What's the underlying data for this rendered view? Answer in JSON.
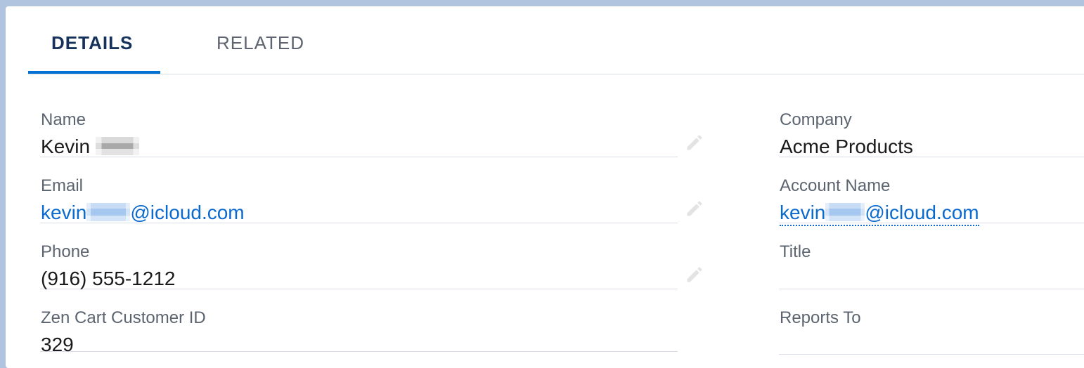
{
  "tabs": [
    {
      "label": "DETAILS",
      "active": true
    },
    {
      "label": "RELATED",
      "active": false
    }
  ],
  "left_fields": [
    {
      "label": "Name",
      "value_prefix": "Kevin",
      "value_suffix": ""
    },
    {
      "label": "Email",
      "value_prefix": "kevin",
      "value_suffix": "@icloud.com"
    },
    {
      "label": "Phone",
      "value": "(916) 555-1212"
    },
    {
      "label": "Zen Cart Customer ID",
      "value": "329"
    }
  ],
  "right_fields": [
    {
      "label": "Company",
      "value": "Acme Products"
    },
    {
      "label": "Account Name",
      "value_prefix": "kevin",
      "value_suffix": "@icloud.com"
    },
    {
      "label": "Title",
      "value": ""
    },
    {
      "label": "Reports To",
      "value": ""
    }
  ],
  "colors": {
    "accent": "#0070d2",
    "link": "#0a6ad0",
    "label": "#5c6470",
    "border": "#d8dde6"
  },
  "icons": [
    "pencil-icon"
  ]
}
